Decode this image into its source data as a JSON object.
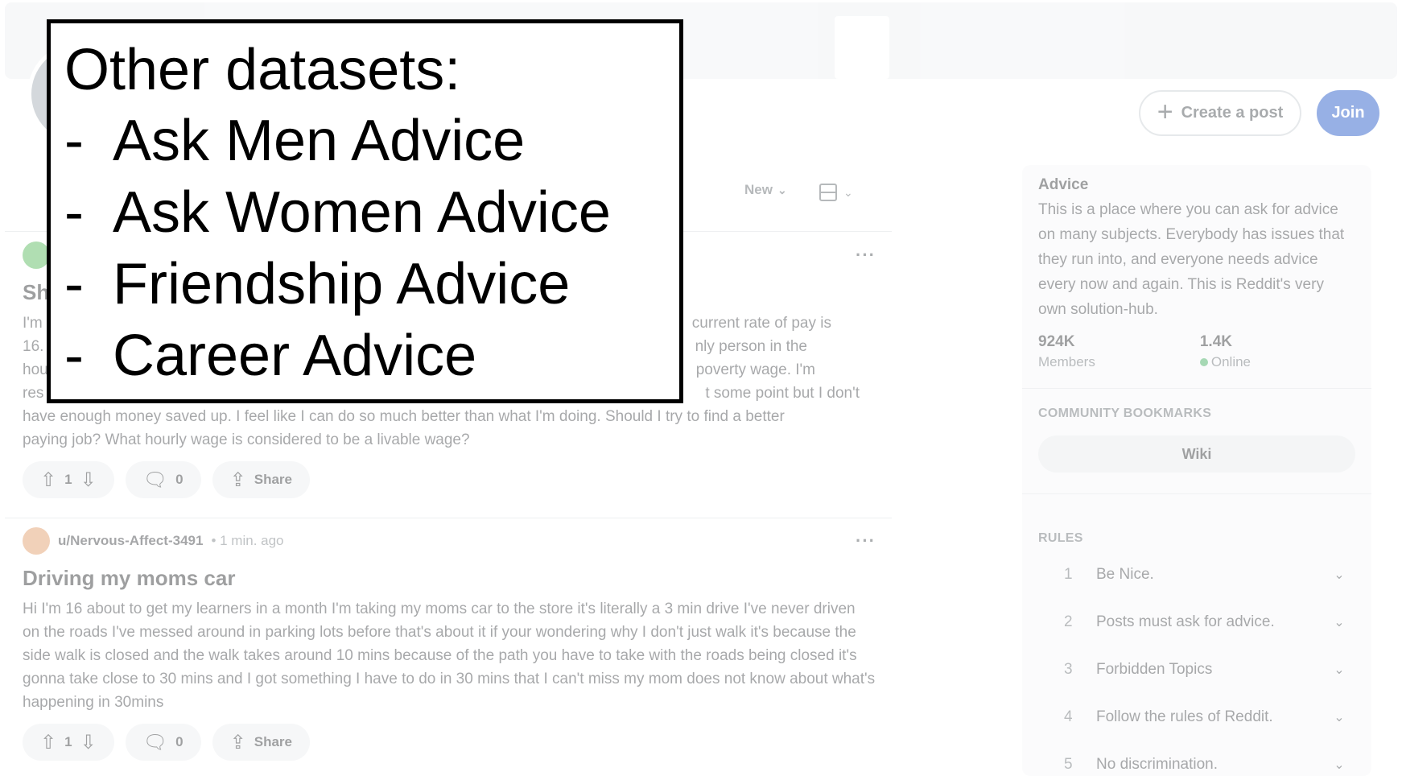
{
  "overlay": {
    "title": "Other datasets:",
    "items": [
      {
        "bullet": "-",
        "label": "Ask Men Advice"
      },
      {
        "bullet": "-",
        "label": "Ask Women Advice"
      },
      {
        "bullet": "-",
        "label": "Friendship Advice"
      },
      {
        "bullet": "-",
        "label": "Career Advice"
      }
    ]
  },
  "header": {
    "create_post_icon": "+",
    "create_post_label": "Create a post",
    "join_label": "Join"
  },
  "sort": {
    "label": "New",
    "chevron": "⌄"
  },
  "posts": [
    {
      "title_fragment": "Sh",
      "body_lines": [
        "I'm",
        "16.",
        "hou",
        "res"
      ],
      "body_visible": "current rate of pay is nly person in the poverty wage. I'm t some point but I don't have enough money saved up. I feel like I can do so much better than what I'm doing. Should I try to find a better paying job? What hourly wage is considered to be a livable wage?",
      "body_right_1": "current rate of pay is",
      "body_right_2": "nly person in the",
      "body_right_3": "poverty wage. I'm",
      "body_right_4": "t some point but I don't",
      "body_line_5": "have enough money saved up. I feel like I can do so much better than what I'm doing. Should I try to find a better",
      "body_line_6": "paying job? What hourly wage is considered to be a livable wage?",
      "votes": "1",
      "comments": "0",
      "share": "Share",
      "more": "···",
      "avatar_color": "#46b34a"
    },
    {
      "author": "u/Nervous-Affect-3491",
      "time": "• 1 min. ago",
      "title": "Driving my moms car",
      "body": "Hi I'm 16 about to get my learners in a month I'm taking my moms car to the store it's literally a 3 min drive I've never driven on the roads I've messed around in parking lots before that's about it if your wondering why I don't just walk it's because the side walk is closed and the walk takes around 10 mins because of the path you have to take with the roads being closed it's gonna take close to 30 mins and I got something I have to do in 30 mins that I can't miss my mom does not know about what's happening in 30mins",
      "votes": "1",
      "comments": "0",
      "share": "Share",
      "more": "···",
      "avatar_color": "#e0935a"
    }
  ],
  "sidebar": {
    "title": "Advice",
    "description": "This is a place where you can ask for advice on many subjects. Everybody has issues that they run into, and everyone needs advice every now and again. This is Reddit's very own solution-hub.",
    "members_count": "924K",
    "members_label": "Members",
    "online_count": "1.4K",
    "online_label": "Online",
    "bookmarks_heading": "COMMUNITY BOOKMARKS",
    "wiki_label": "Wiki",
    "rules_heading": "RULES",
    "rules": [
      {
        "num": "1",
        "text": "Be Nice."
      },
      {
        "num": "2",
        "text": "Posts must ask for advice."
      },
      {
        "num": "3",
        "text": "Forbidden Topics"
      },
      {
        "num": "4",
        "text": "Follow the rules of Reddit."
      },
      {
        "num": "5",
        "text": "No discrimination."
      }
    ]
  },
  "icons": {
    "upvote": "⇧",
    "downvote": "⇩",
    "comment": "🗨",
    "share": "⇪",
    "rule_chevron": "⌄"
  },
  "colors": {
    "join_button": "#0a44c2",
    "online_dot": "#2ea44f"
  }
}
